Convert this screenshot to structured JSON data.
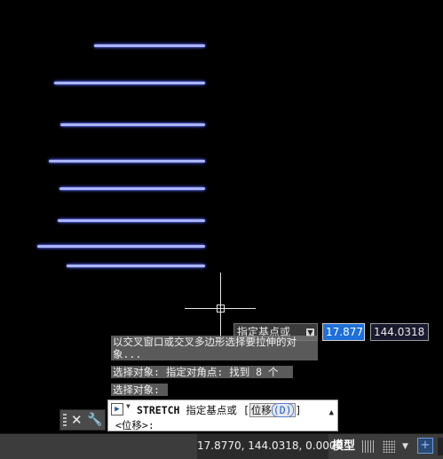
{
  "tooltip": {
    "prompt": "指定基点或",
    "arrow": "▼",
    "x_value": "17.877",
    "y_value": "144.0318"
  },
  "history": [
    "以交叉窗口或交叉多边形选择要拉伸的对象...",
    "选择对象: 指定对角点: 找到 8 个",
    "选择对象:"
  ],
  "command_bar": {
    "close": "✕",
    "customize": "🔧"
  },
  "command_line": {
    "icon": "▶",
    "dropdown": "▼",
    "command": "STRETCH",
    "prompt": "指定基点或",
    "open_bracket": "[",
    "option": "位移",
    "option_key": "(D)",
    "close_bracket": "]",
    "line2": "<位移>:",
    "scroll": "▲"
  },
  "status_bar": {
    "coordinates": "17.8770, 144.0318, 0.0000",
    "model": "模型",
    "dropdown": "▼"
  },
  "colors": {
    "background": "#000000",
    "selected_lines": "#aab4ff",
    "crosshair": "#e6e6e6",
    "input_active": "#1e6fd9"
  }
}
